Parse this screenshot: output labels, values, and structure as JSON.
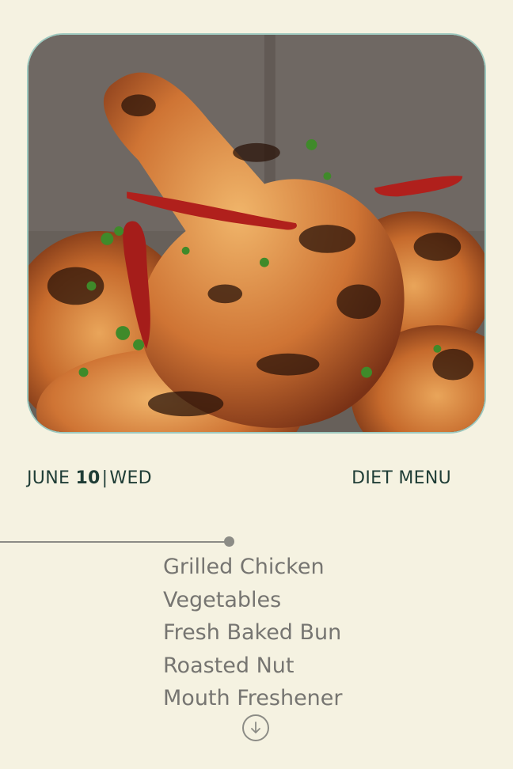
{
  "header": {
    "month": "JUNE",
    "day": "10",
    "separator": "|",
    "weekday": "WED",
    "title": "DIET MENU"
  },
  "hero_image": {
    "icon": "grilled-chicken-photo"
  },
  "menu": {
    "items": [
      "Grilled Chicken",
      "Vegetables",
      "Fresh Baked Bun",
      "Roasted Nut",
      "Mouth Freshener"
    ]
  },
  "scroll": {
    "icon": "arrow-down-circle-icon"
  },
  "colors": {
    "background": "#f5f2e1",
    "accent_text": "#1f3d36",
    "menu_text": "#767571",
    "card_border": "#9ec9bf"
  }
}
